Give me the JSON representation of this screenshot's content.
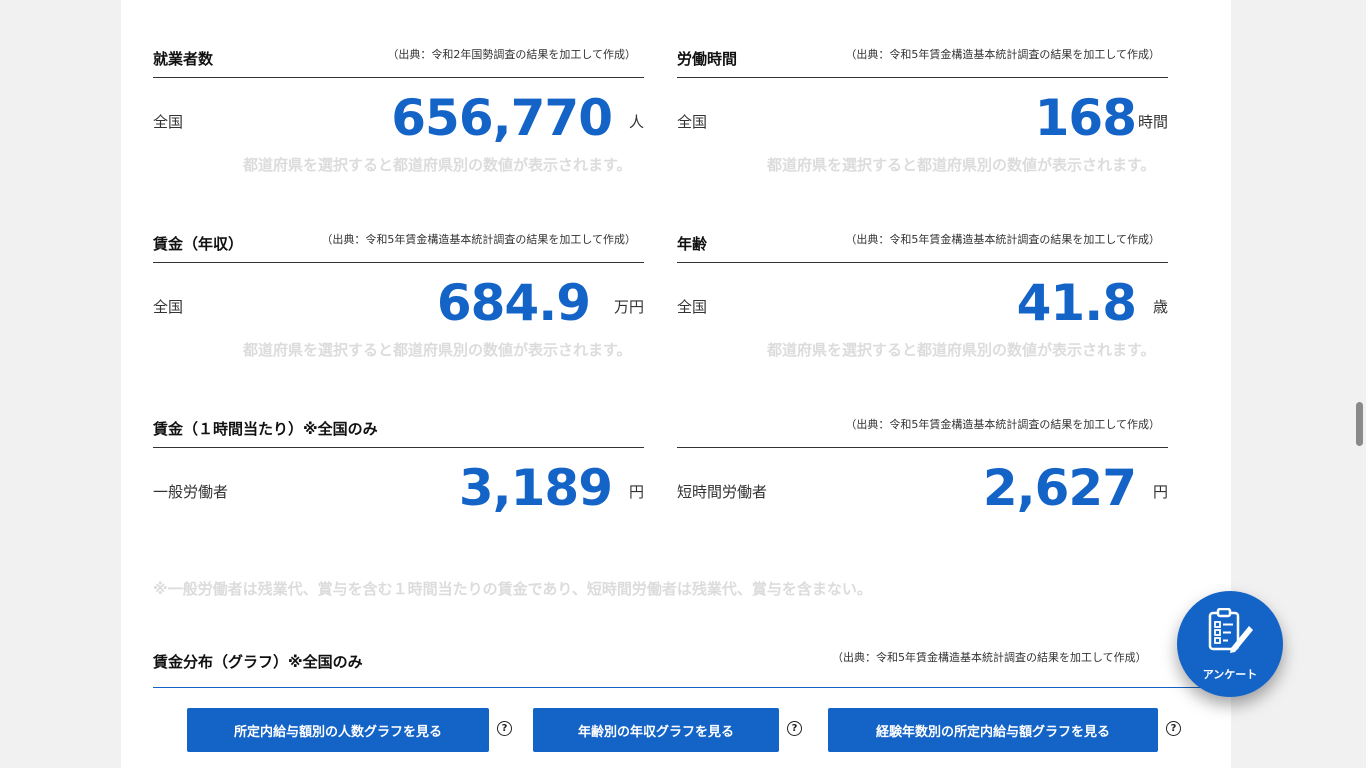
{
  "employees": {
    "title": "就業者数",
    "source": "（出典：令和2年国勢調査の結果を加工して作成）",
    "label": "全国",
    "value": "656,770",
    "unit": "人",
    "pref_note": "都道府県を選択すると都道府県別の数値が表示されます。"
  },
  "work_hours": {
    "title": "労働時間",
    "source": "（出典：令和5年賃金構造基本統計調査の結果を加工して作成）",
    "label": "全国",
    "value": "168",
    "unit": "時間",
    "pref_note": "都道府県を選択すると都道府県別の数値が表示されます。"
  },
  "annual_wage": {
    "title": "賃金（年収）",
    "source": "（出典：令和5年賃金構造基本統計調査の結果を加工して作成）",
    "label": "全国",
    "value": "684.9",
    "unit": "万円",
    "pref_note": "都道府県を選択すると都道府県別の数値が表示されます。"
  },
  "age": {
    "title": "年齢",
    "source": "（出典：令和5年賃金構造基本統計調査の結果を加工して作成）",
    "label": "全国",
    "value": "41.8",
    "unit": "歳",
    "pref_note": "都道府県を選択すると都道府県別の数値が表示されます。"
  },
  "hourly_wage": {
    "title": "賃金（１時間当たり）※全国のみ",
    "source": "（出典：令和5年賃金構造基本統計調査の結果を加工して作成）",
    "general": {
      "label": "一般労働者",
      "value": "3,189",
      "unit": "円"
    },
    "part_time": {
      "label": "短時間労働者",
      "value": "2,627",
      "unit": "円"
    },
    "footnote": "※一般労働者は残業代、賞与を含む１時間当たりの賃金であり、短時間労働者は残業代、賞与を含まない。"
  },
  "distribution": {
    "title": "賃金分布（グラフ）※全国のみ",
    "source": "（出典：令和5年賃金構造基本統計調査の結果を加工して作成）",
    "buttons": [
      "所定内給与額別の人数グラフを見る",
      "年齢別の年収グラフを見る",
      "経験年数別の所定内給与額グラフを見る"
    ],
    "help_glyph": "?"
  },
  "survey": {
    "label": "アンケート",
    "icon": "clipboard-pen-icon"
  },
  "colors": {
    "accent": "#1464c8",
    "muted_note": "#dcdcdc"
  }
}
